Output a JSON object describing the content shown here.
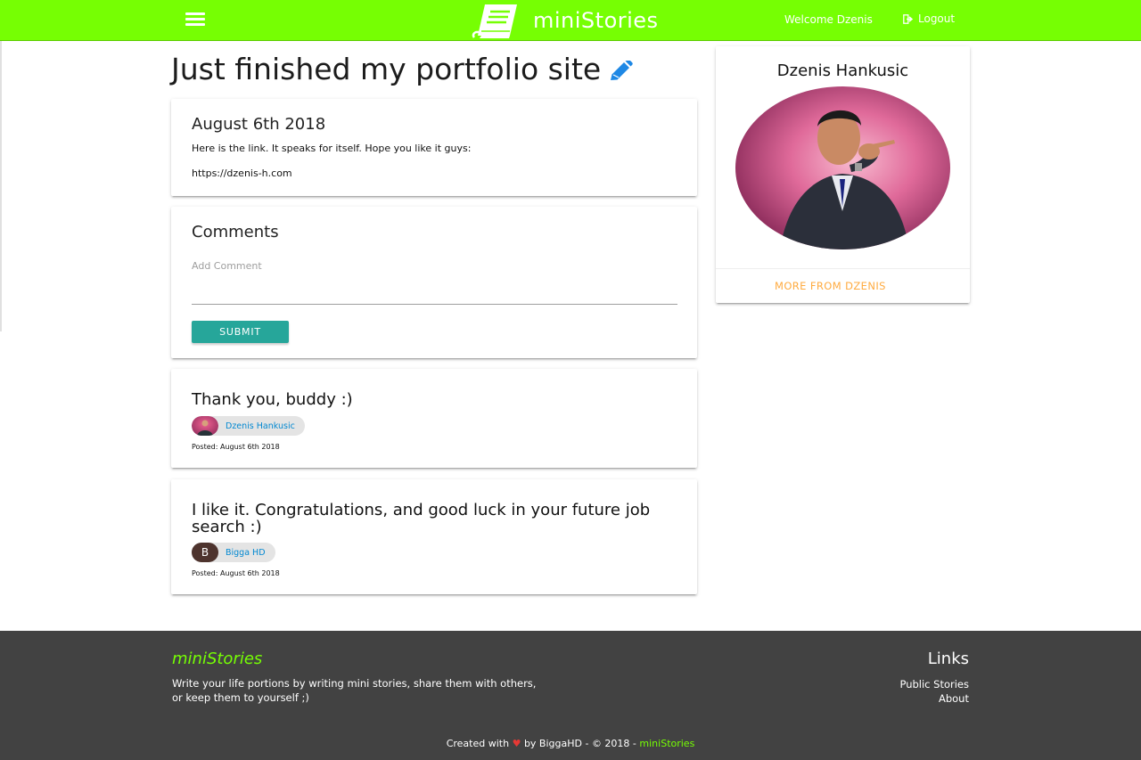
{
  "header": {
    "brand": "miniStories",
    "welcome": "Welcome Dzenis",
    "logout": "Logout"
  },
  "story": {
    "title": "Just finished my portfolio site",
    "date": "August 6th 2018",
    "paragraphs": [
      "Here is the link. It speaks for itself. Hope you like it guys:",
      "https://dzenis-h.com"
    ]
  },
  "comments_section": {
    "title": "Comments",
    "input_label": "Add Comment",
    "input_value": "",
    "submit_label": "SUBMIT"
  },
  "comments": [
    {
      "text": "Thank you, buddy :)",
      "author": "Dzenis Hankusic",
      "posted": "Posted: August 6th 2018"
    },
    {
      "text": "I like it. Congratulations, and good luck in your future job search :)",
      "author": "Bigga HD",
      "author_initial": "B",
      "posted": "Posted: August 6th 2018"
    }
  ],
  "author_card": {
    "name": "Dzenis Hankusic",
    "more_link": "MORE FROM DZENIS"
  },
  "footer": {
    "brand": "miniStories",
    "description": "Write your life portions by writing mini stories, share them with others, or keep them to yourself ;)",
    "links_title": "Links",
    "links": [
      "Public Stories",
      "About"
    ],
    "credit_before": "Created with",
    "heart": "♥",
    "credit_after": "by BiggaHD - © 2018 -",
    "credit_brand": "miniStories"
  },
  "colors": {
    "navbar": "#76ff03",
    "submit": "#26a69a",
    "link_blue": "#0288d1",
    "more_link": "#ffab40",
    "footer_bg": "#424242"
  }
}
